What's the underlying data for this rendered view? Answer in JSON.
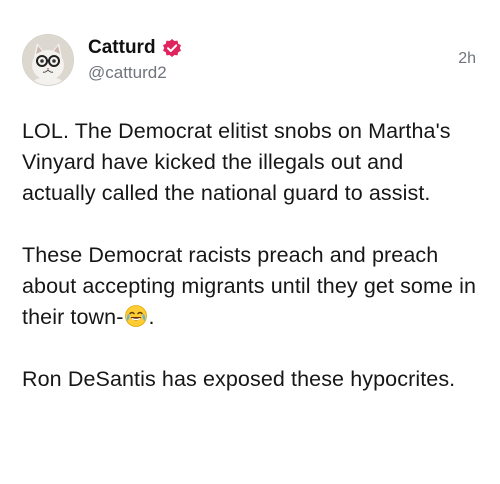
{
  "author": {
    "display_name": "Catturd",
    "handle": "@catturd2",
    "avatar": "cat-avatar",
    "verified_icon": "verified-badge-icon",
    "verified_color": "#e0245e"
  },
  "timestamp": "2h",
  "post": {
    "paragraph_1": "LOL. The Democrat elitist snobs on Martha's Vinyard have kicked the illegals out and actually called the national guard to assist.",
    "paragraph_2_text": "These Democrat racists preach and preach about accepting migrants until they get some in their town-",
    "paragraph_2_emoji": "tears-of-joy-emoji",
    "paragraph_2_end": ".",
    "paragraph_3": "Ron DeSantis has exposed these hypocrites."
  }
}
